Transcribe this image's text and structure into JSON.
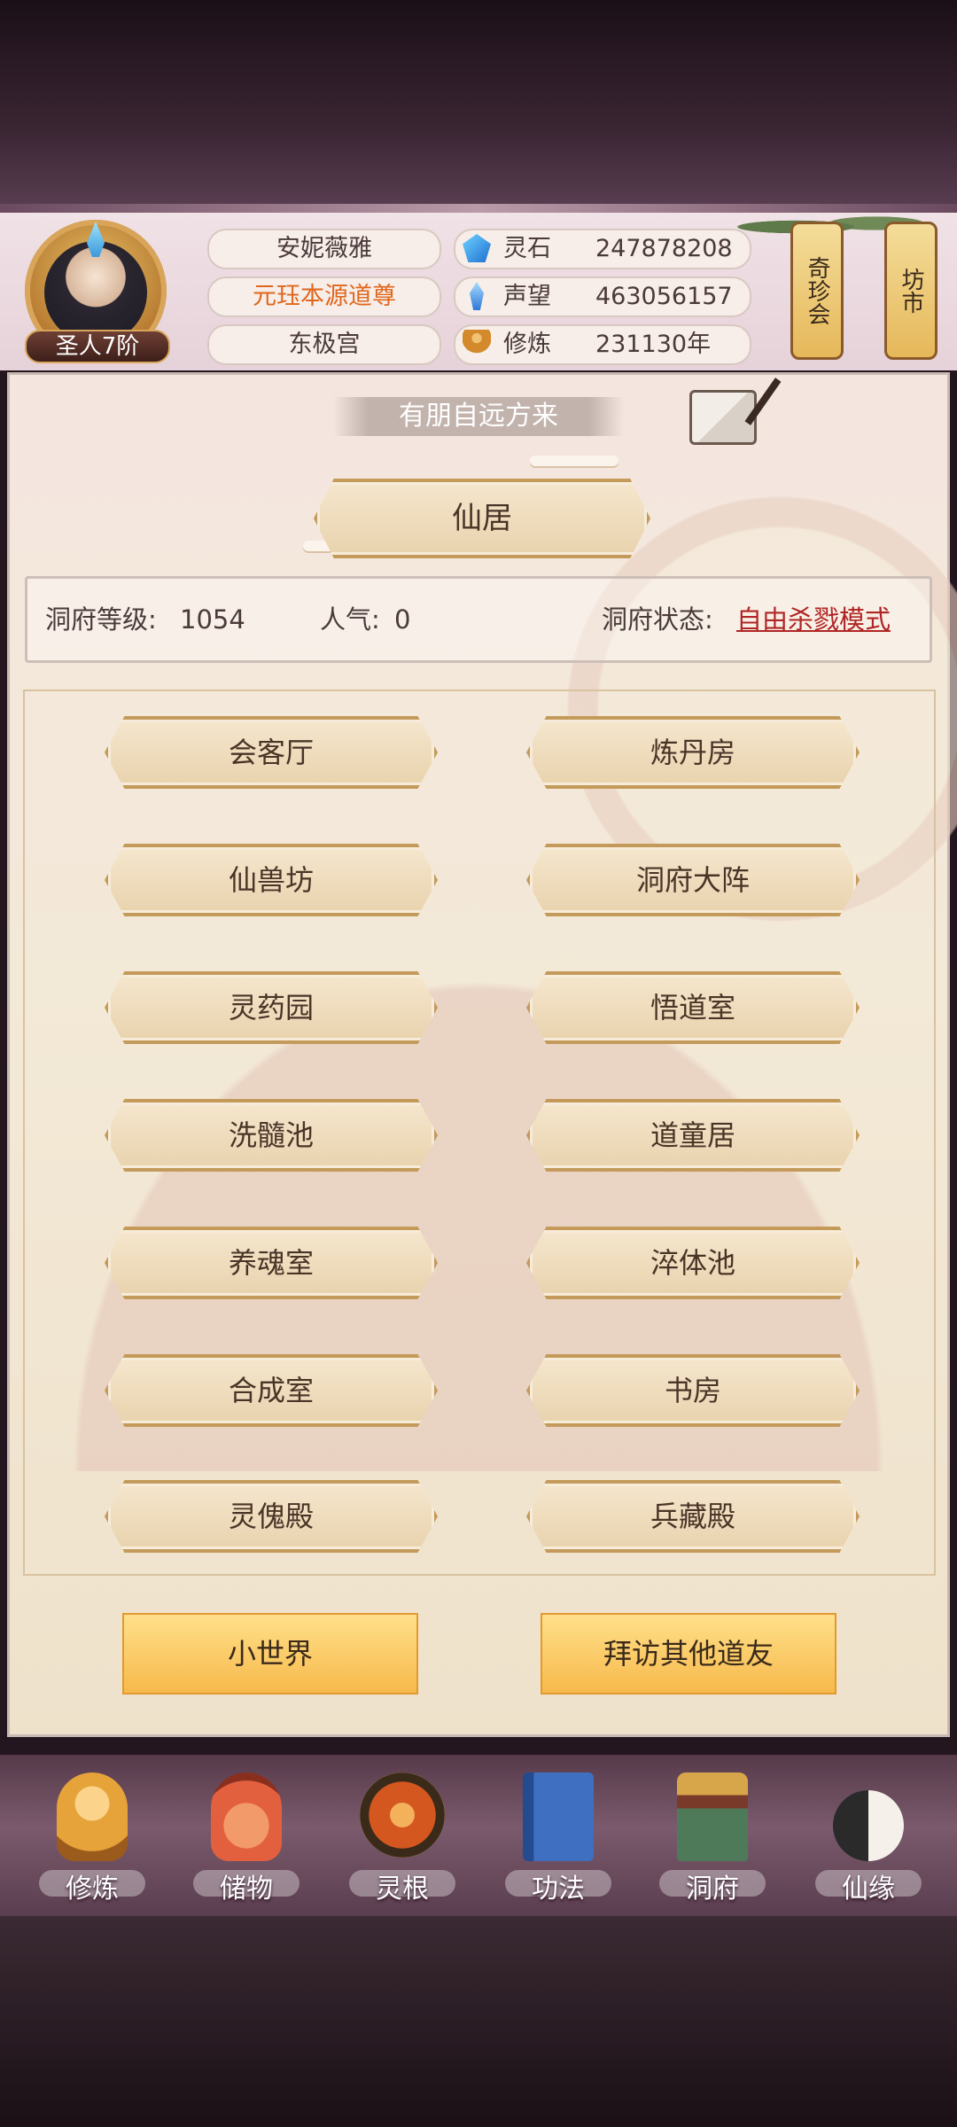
{
  "player": {
    "rank": "圣人7阶",
    "name": "安妮薇雅",
    "title": "元珏本源道尊",
    "location": "东极宫"
  },
  "resources": [
    {
      "icon": "spirit-stone-icon",
      "label": "灵石",
      "value": "247878208"
    },
    {
      "icon": "reputation-icon",
      "label": "声望",
      "value": "463056157"
    },
    {
      "icon": "cultivation-icon",
      "label": "修炼",
      "value": "231130年"
    }
  ],
  "side_buttons": {
    "treasure": "奇珍会",
    "market": "坊市"
  },
  "panel": {
    "banner": "有朋自远方来",
    "main_plaque": "仙居",
    "info": {
      "level_label": "洞府等级:",
      "level_value": "1054",
      "popularity_label": "人气:",
      "popularity_value": "0",
      "status_label": "洞府状态:",
      "status_value": "自由杀戮模式"
    },
    "buildings": [
      "会客厅",
      "炼丹房",
      "仙兽坊",
      "洞府大阵",
      "灵药园",
      "悟道室",
      "洗髓池",
      "道童居",
      "养魂室",
      "淬体池",
      "合成室",
      "书房",
      "灵傀殿",
      "兵藏殿"
    ],
    "actions": {
      "small_world": "小世界",
      "visit_friends": "拜访其他道友"
    }
  },
  "nav": [
    {
      "label": "修炼",
      "icon": "cultivation-monk-icon",
      "color": "#e6a33a"
    },
    {
      "label": "储物",
      "icon": "storage-bag-icon",
      "color": "#e3603f"
    },
    {
      "label": "灵根",
      "icon": "spirit-root-icon",
      "color": "#d4571f"
    },
    {
      "label": "功法",
      "icon": "technique-book-icon",
      "color": "#3f6fc0"
    },
    {
      "label": "洞府",
      "icon": "cave-gate-icon",
      "color": "#b48a3a"
    },
    {
      "label": "仙缘",
      "icon": "fate-gourd-icon",
      "color": "#2a2a2a"
    }
  ]
}
